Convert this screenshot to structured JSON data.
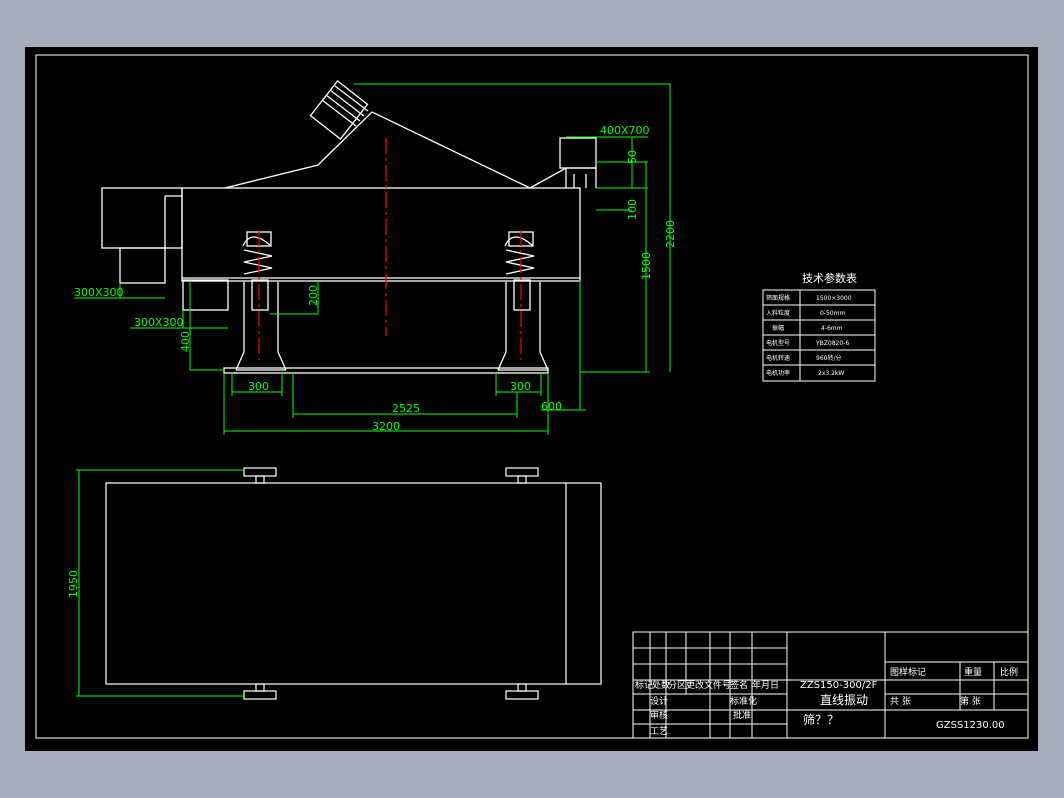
{
  "drawing": {
    "code": "GZSS1230.00",
    "model": "ZZS150-300/2F",
    "name_line1": "直线振动",
    "name_line2": "筛？？"
  },
  "dimensions": {
    "feed_inlet": "400X700",
    "d_50": "50",
    "d_100": "100",
    "d_1500": "1500",
    "d_2200": "2200",
    "outlet_upper": "300X300",
    "outlet_lower": "300X300",
    "d_200": "200",
    "d_400": "400",
    "spring_base_left": "300",
    "spring_base_right": "300",
    "spring_span": "2525",
    "d_600": "600",
    "overall_length": "3200",
    "overall_width": "1950"
  },
  "tech_table": {
    "title": "技术参数表",
    "rows": [
      {
        "label": "筛面规格",
        "value": "1500×3000"
      },
      {
        "label": "入料粒度",
        "value": "0-50mm"
      },
      {
        "label": "振幅",
        "value": "4-6mm"
      },
      {
        "label": "电机型号",
        "value": "YBZ0820-6"
      },
      {
        "label": "电机转速",
        "value": "960转/分"
      },
      {
        "label": "电机功率",
        "value": "2x3.2kW"
      }
    ]
  },
  "title_block": {
    "col1": "标记",
    "col2": "处数",
    "col3": "分区",
    "col4": "更改文件号",
    "col5": "签名",
    "col6": "年月日",
    "row_design": "设计",
    "row_std": "标准化",
    "row_check": "审核",
    "row_process": "工艺",
    "row_approve": "批准",
    "stage_label": "图样标记",
    "weight_label": "重量",
    "scale_label": "比例",
    "sheets_total": "共 张",
    "sheet_no": "第 张"
  },
  "colors": {
    "dimension": "#00ff00",
    "outline": "#ffffff",
    "centerline": "#ff0000",
    "background": "#000000",
    "sheet": "#a5adbb"
  }
}
